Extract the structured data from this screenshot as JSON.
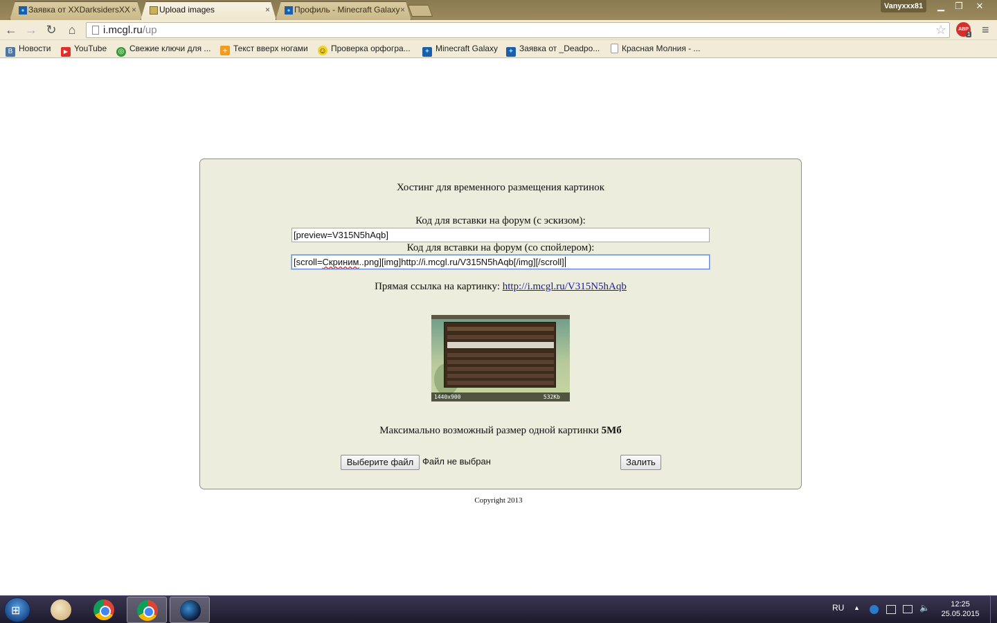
{
  "browser": {
    "tabs": [
      {
        "title": "Заявка от XXDarksidersXX",
        "active": false
      },
      {
        "title": "Upload images",
        "active": true
      },
      {
        "title": "Профиль - Minecraft Galaxy",
        "active": false
      }
    ],
    "tab_close": "×",
    "profile": "Vanyxxx81",
    "window_controls": {
      "minimize": "▁",
      "maximize": "❐",
      "close": "✕"
    },
    "nav": {
      "back": "←",
      "forward": "→",
      "reload": "↻",
      "home": "⌂"
    },
    "url_host": "i.mcgl.ru",
    "url_path": "/up",
    "star": "☆",
    "abp": {
      "label": "ABP",
      "count": "1"
    },
    "menu": "≡"
  },
  "bookmarks": [
    {
      "label": "Новости",
      "icon": "vk-icon",
      "color": "#4a76a8",
      "glyph": "B"
    },
    {
      "label": "YouTube",
      "icon": "youtube-icon",
      "color": "#e52d27",
      "glyph": "▶"
    },
    {
      "label": "Свежие ключи для ...",
      "icon": "key-site-icon",
      "color": "#3a9a3a",
      "glyph": "◎"
    },
    {
      "label": "Текст вверх ногами",
      "icon": "flip-text-icon",
      "color": "#f29b1c",
      "glyph": "+"
    },
    {
      "label": "Проверка орфогра...",
      "icon": "smiley-icon",
      "color": "#f4d21e",
      "glyph": "☺"
    },
    {
      "label": "Minecraft Galaxy",
      "icon": "minecraft-galaxy-icon",
      "color": "#1b5fa8",
      "glyph": "✦"
    },
    {
      "label": "Заявка от _Deadpo...",
      "icon": "minecraft-galaxy-icon",
      "color": "#1b5fa8",
      "glyph": "✦"
    },
    {
      "label": "Красная Молния - ...",
      "icon": "page-icon",
      "color": "#ffffff",
      "glyph": ""
    }
  ],
  "page": {
    "title": "Хостинг для временного размещения картинок",
    "preview_label": "Код для вставки на форум (с эскизом):",
    "preview_code": "[preview=V315N5hAqb]",
    "spoiler_label": "Код для вставки на форум (со спойлером):",
    "spoiler_code_prefix": "[scroll=",
    "spoiler_code_squiggle": "Скриним",
    "spoiler_code_rest": "..png][img]http://i.mcgl.ru/V315N5hAqb[/img][/scroll]",
    "direct_label": "Прямая ссылка на картинку:",
    "direct_url": "http://i.mcgl.ru/V315N5hAqb",
    "thumb_dims": "1440x900",
    "thumb_size": "532Kb",
    "maxsize_label": "Максимально возможный размер одной картинки",
    "maxsize_value": "5Мб",
    "choose_file": "Выберите файл",
    "no_file": "Файл не выбран",
    "upload": "Залить",
    "copyright": "Copyright 2013"
  },
  "taskbar": {
    "start": "⊞",
    "lang": "RU",
    "tray_arrow": "▲",
    "time": "12:25",
    "date": "25.05.2015"
  }
}
